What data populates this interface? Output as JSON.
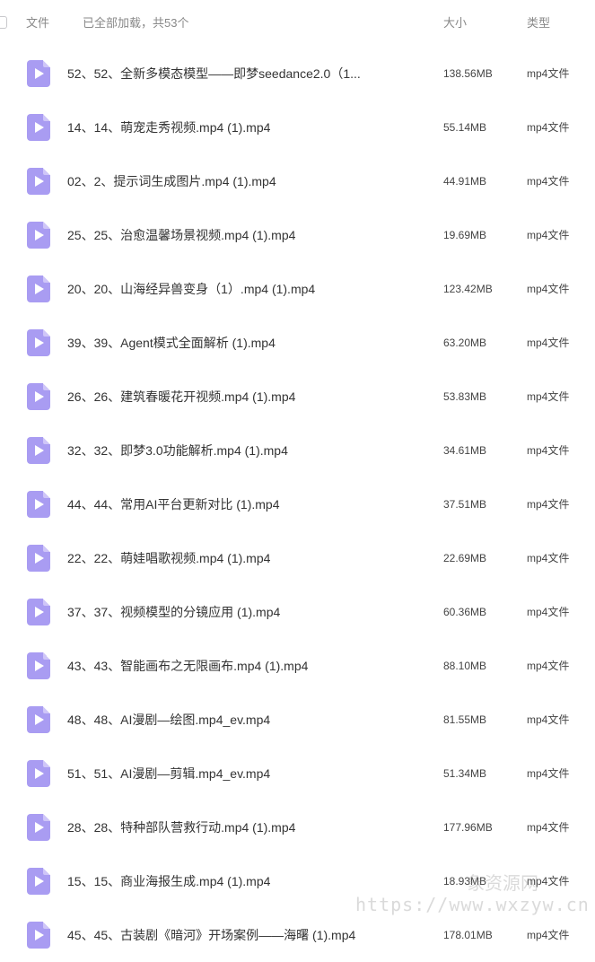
{
  "header": {
    "name_label": "文件",
    "status": "已全部加载，共53个",
    "size_label": "大小",
    "type_label": "类型"
  },
  "icon": {
    "name": "video-file-icon",
    "color": "#a99cf2"
  },
  "files": [
    {
      "name": "52、52、全新多模态模型——即梦seedance2.0（1...",
      "size": "138.56MB",
      "type": "mp4文件"
    },
    {
      "name": "14、14、萌宠走秀视频.mp4 (1).mp4",
      "size": "55.14MB",
      "type": "mp4文件"
    },
    {
      "name": "02、2、提示词生成图片.mp4 (1).mp4",
      "size": "44.91MB",
      "type": "mp4文件"
    },
    {
      "name": "25、25、治愈温馨场景视频.mp4 (1).mp4",
      "size": "19.69MB",
      "type": "mp4文件"
    },
    {
      "name": "20、20、山海经异兽变身（1）.mp4 (1).mp4",
      "size": "123.42MB",
      "type": "mp4文件"
    },
    {
      "name": "39、39、Agent模式全面解析 (1).mp4",
      "size": "63.20MB",
      "type": "mp4文件"
    },
    {
      "name": "26、26、建筑春暖花开视频.mp4 (1).mp4",
      "size": "53.83MB",
      "type": "mp4文件"
    },
    {
      "name": "32、32、即梦3.0功能解析.mp4 (1).mp4",
      "size": "34.61MB",
      "type": "mp4文件"
    },
    {
      "name": "44、44、常用AI平台更新对比 (1).mp4",
      "size": "37.51MB",
      "type": "mp4文件"
    },
    {
      "name": "22、22、萌娃唱歌视频.mp4 (1).mp4",
      "size": "22.69MB",
      "type": "mp4文件"
    },
    {
      "name": "37、37、视频模型的分镜应用 (1).mp4",
      "size": "60.36MB",
      "type": "mp4文件"
    },
    {
      "name": "43、43、智能画布之无限画布.mp4 (1).mp4",
      "size": "88.10MB",
      "type": "mp4文件"
    },
    {
      "name": "48、48、AI漫剧—绘图.mp4_ev.mp4",
      "size": "81.55MB",
      "type": "mp4文件"
    },
    {
      "name": "51、51、AI漫剧—剪辑.mp4_ev.mp4",
      "size": "51.34MB",
      "type": "mp4文件"
    },
    {
      "name": "28、28、特种部队营救行动.mp4 (1).mp4",
      "size": "177.96MB",
      "type": "mp4文件"
    },
    {
      "name": "15、15、商业海报生成.mp4 (1).mp4",
      "size": "18.93MB",
      "type": "mp4文件"
    },
    {
      "name": "45、45、古装剧《暗河》开场案例——海曙 (1).mp4",
      "size": "178.01MB",
      "type": "mp4文件"
    }
  ],
  "watermark": {
    "cn": "象资源网",
    "url": "https://www.wxzyw.cn"
  }
}
